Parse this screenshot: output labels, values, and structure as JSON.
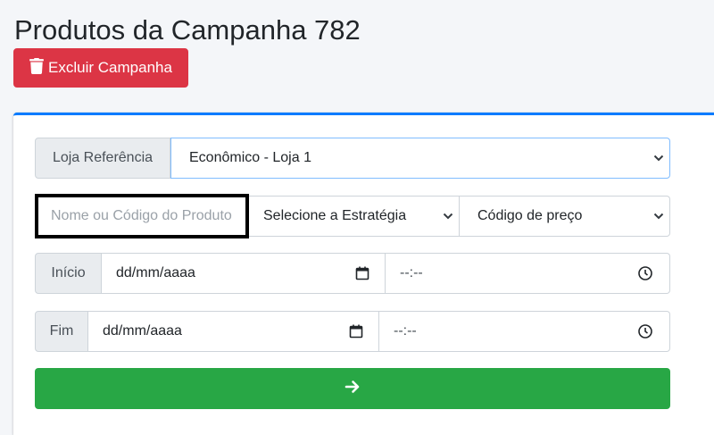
{
  "page": {
    "title": "Produtos da Campanha 782",
    "delete_button": "Excluir Campanha"
  },
  "form": {
    "store_label": "Loja Referência",
    "store_value": "Econômico - Loja 1",
    "product_placeholder": "Nome ou Código do Produto",
    "strategy_value": "Selecione a Estratégia",
    "price_code_value": "Código de preço",
    "start_label": "Início",
    "start_date": "dd/mm/aaaa",
    "start_time": "--:--",
    "end_label": "Fim",
    "end_date": "dd/mm/aaaa",
    "end_time": "--:--"
  },
  "colors": {
    "danger": "#dc3545",
    "success": "#28a745",
    "primary": "#007bff"
  },
  "icons": {
    "delete": "trash-icon",
    "submit": "arrow-right-icon",
    "calendar": "calendar-icon",
    "clock": "clock-icon",
    "chevron": "chevron-down-icon"
  }
}
